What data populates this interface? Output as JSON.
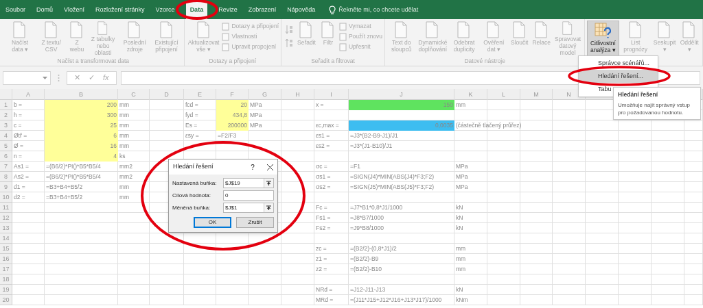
{
  "tabs": [
    {
      "label": "Soubor",
      "selected": false
    },
    {
      "label": "Domů",
      "selected": false
    },
    {
      "label": "Vložení",
      "selected": false
    },
    {
      "label": "Rozložení stránky",
      "selected": false
    },
    {
      "label": "Vzorce",
      "selected": false
    },
    {
      "label": "Data",
      "selected": true
    },
    {
      "label": "Revize",
      "selected": false
    },
    {
      "label": "Zobrazení",
      "selected": false
    },
    {
      "label": "Nápověda",
      "selected": false
    }
  ],
  "tell_me": {
    "placeholder": "Řekněte mi, co chcete udělat"
  },
  "ribbon": {
    "groups": [
      {
        "label": "Načíst a transformovat data",
        "buttons": [
          {
            "kind": "large",
            "label": "Načíst data ▾",
            "pressed": false
          },
          {
            "kind": "large",
            "label": "Z textu/ CSV",
            "pressed": false
          },
          {
            "kind": "large",
            "label": "Z webu",
            "pressed": false
          },
          {
            "kind": "large",
            "label": "Z tabulky nebo oblasti",
            "pressed": false
          },
          {
            "kind": "large",
            "label": "Poslední zdroje",
            "pressed": false
          },
          {
            "kind": "large",
            "label": "Existující připojení",
            "pressed": false
          }
        ]
      },
      {
        "label": "Dotazy a připojení",
        "buttons": [
          {
            "kind": "large",
            "label": "Aktualizovat vše ▾",
            "pressed": false
          },
          {
            "kind": "small",
            "label": "Dotazy a připojení",
            "pressed": false
          },
          {
            "kind": "small",
            "label": "Vlastnosti",
            "pressed": false
          },
          {
            "kind": "small",
            "label": "Upravit propojení",
            "pressed": false
          }
        ]
      },
      {
        "label": "Seřadit a filtrovat",
        "buttons": [
          {
            "kind": "icons",
            "pressed": false
          },
          {
            "kind": "large",
            "label": "Seřadit",
            "pressed": false
          },
          {
            "kind": "large",
            "label": "Filtr",
            "pressed": false
          },
          {
            "kind": "small",
            "label": "Vymazat",
            "pressed": false
          },
          {
            "kind": "small",
            "label": "Použít znovu",
            "pressed": false
          },
          {
            "kind": "small",
            "label": "Upřesnit",
            "pressed": false
          }
        ]
      },
      {
        "label": "Datové nástroje",
        "buttons": [
          {
            "kind": "large",
            "label": "Text do sloupců",
            "pressed": false
          },
          {
            "kind": "large",
            "label": "Dynamické doplňování",
            "pressed": false
          },
          {
            "kind": "large",
            "label": "Odebrat duplicity",
            "pressed": false
          },
          {
            "kind": "large",
            "label": "Ověření dat ▾",
            "pressed": false
          },
          {
            "kind": "large",
            "label": "Sloučit",
            "pressed": false
          },
          {
            "kind": "large",
            "label": "Relace",
            "pressed": false
          },
          {
            "kind": "large",
            "label": "Spravovat datový model",
            "pressed": false
          }
        ]
      },
      {
        "buttons": [
          {
            "kind": "large",
            "label": "Citlivostní analýza ▾",
            "pressed": true
          },
          {
            "kind": "large",
            "label": "List prognózy",
            "pressed": false
          },
          {
            "kind": "large",
            "label": "Seskupit ▾",
            "pressed": false
          },
          {
            "kind": "large",
            "label": "Oddělit ▾",
            "pressed": false
          }
        ]
      }
    ]
  },
  "formula_bar": {
    "cancel": "✕",
    "enter": "✓",
    "function": "fx"
  },
  "columns": [
    "A",
    "B",
    "C",
    "D",
    "E",
    "F",
    "G",
    "H",
    "I",
    "J",
    "K",
    "L",
    "M",
    "N"
  ],
  "rows": [
    {
      "number": "1",
      "cells": [
        {
          "kind": "text",
          "text": "b ="
        },
        {
          "kind": "number",
          "text": "200",
          "color": "#ffff99"
        },
        {
          "kind": "text",
          "text": "mm"
        },
        {},
        {
          "kind": "text",
          "text": "fcd ="
        },
        {
          "kind": "number",
          "text": "20",
          "color": "#ffff99"
        },
        {
          "kind": "text",
          "text": "MPa"
        },
        {},
        {
          "kind": "text",
          "text": "x ="
        },
        {
          "kind": "number",
          "text": "150",
          "color": "#5fe35f"
        },
        {
          "kind": "text",
          "text": "mm"
        }
      ]
    },
    {
      "number": "2",
      "cells": [
        {
          "kind": "text",
          "text": "h ="
        },
        {
          "kind": "number",
          "text": "300",
          "color": "#ffff99"
        },
        {
          "kind": "text",
          "text": "mm"
        },
        {},
        {
          "kind": "text",
          "text": "fyd ="
        },
        {
          "kind": "number",
          "text": "434,8",
          "color": "#ffff99"
        },
        {
          "kind": "text",
          "text": "MPa"
        }
      ]
    },
    {
      "number": "3",
      "cells": [
        {
          "kind": "text",
          "text": "c ="
        },
        {
          "kind": "number",
          "text": "25",
          "color": "#ffff99"
        },
        {
          "kind": "text",
          "text": "mm"
        },
        {},
        {
          "kind": "text",
          "text": "Es ="
        },
        {
          "kind": "number",
          "text": "200000",
          "color": "#ffff99"
        },
        {
          "kind": "text",
          "text": "MPa"
        },
        {},
        {
          "kind": "text",
          "text": "εc,max ="
        },
        {
          "kind": "number",
          "text": "0,0035",
          "color": "#3dbdf0"
        },
        {
          "kind": "text",
          "text": "(částečně tlačený průřez)"
        }
      ]
    },
    {
      "number": "4",
      "cells": [
        {
          "kind": "text",
          "text": "Øtř ="
        },
        {
          "kind": "number",
          "text": "6",
          "color": "#ffff99"
        },
        {
          "kind": "text",
          "text": "mm"
        },
        {},
        {
          "kind": "text",
          "text": "εsy ="
        },
        {
          "kind": "text",
          "text": "=F2/F3"
        },
        {},
        {},
        {
          "kind": "text",
          "text": "εs1 ="
        },
        {
          "kind": "text",
          "text": "=J3*(B2-B9-J1)/J1"
        }
      ]
    },
    {
      "number": "5",
      "cells": [
        {
          "kind": "text",
          "text": "Ø ="
        },
        {
          "kind": "number",
          "text": "16",
          "color": "#ffff99"
        },
        {
          "kind": "text",
          "text": "mm"
        },
        {},
        {},
        {},
        {},
        {},
        {
          "kind": "text",
          "text": "εs2 ="
        },
        {
          "kind": "text",
          "text": "=J3*(J1-B10)/J1"
        }
      ]
    },
    {
      "number": "6",
      "cells": [
        {
          "kind": "text",
          "text": "n ="
        },
        {
          "kind": "number",
          "text": "4",
          "color": "#ffff99"
        },
        {
          "kind": "text",
          "text": "ks"
        }
      ]
    },
    {
      "number": "7",
      "cells": [
        {
          "kind": "text",
          "text": "As1 ="
        },
        {
          "kind": "text",
          "text": "=(B6/2)*PI()*B5*B5/4"
        },
        {
          "kind": "text",
          "text": "mm2"
        },
        {},
        {},
        {},
        {},
        {},
        {
          "kind": "text",
          "text": "σc ="
        },
        {
          "kind": "text",
          "text": "=F1"
        },
        {
          "kind": "text",
          "text": "MPa"
        }
      ]
    },
    {
      "number": "8",
      "cells": [
        {
          "kind": "text",
          "text": "As2 ="
        },
        {
          "kind": "text",
          "text": "=(B6/2)*PI()*B5*B5/4"
        },
        {
          "kind": "text",
          "text": "mm2"
        },
        {},
        {},
        {},
        {},
        {},
        {
          "kind": "text",
          "text": "σs1 ="
        },
        {
          "kind": "text",
          "text": "=SIGN(J4)*MIN(ABS(J4)*F3;F2)"
        },
        {
          "kind": "text",
          "text": "MPa"
        }
      ]
    },
    {
      "number": "9",
      "cells": [
        {
          "kind": "text",
          "text": "d1 ="
        },
        {
          "kind": "text",
          "text": "=B3+B4+B5/2"
        },
        {
          "kind": "text",
          "text": "mm"
        },
        {},
        {},
        {},
        {},
        {},
        {
          "kind": "text",
          "text": "σs2 ="
        },
        {
          "kind": "text",
          "text": "=SIGN(J5)*MIN(ABS(J5)*F3;F2)"
        },
        {
          "kind": "text",
          "text": "MPa"
        }
      ]
    },
    {
      "number": "10",
      "cells": [
        {
          "kind": "text",
          "text": "d2 ="
        },
        {
          "kind": "text",
          "text": "=B3+B4+B5/2"
        },
        {
          "kind": "text",
          "text": "mm"
        }
      ]
    },
    {
      "number": "11",
      "cells": [
        {},
        {},
        {},
        {},
        {},
        {},
        {},
        {},
        {
          "kind": "text",
          "text": "Fc ="
        },
        {
          "kind": "text",
          "text": "=J7*B1*0,8*J1/1000"
        },
        {
          "kind": "text",
          "text": "kN"
        }
      ]
    },
    {
      "number": "12",
      "cells": [
        {},
        {},
        {},
        {},
        {},
        {},
        {},
        {},
        {
          "kind": "text",
          "text": "Fs1 ="
        },
        {
          "kind": "text",
          "text": "=J8*B7/1000"
        },
        {
          "kind": "text",
          "text": "kN"
        }
      ]
    },
    {
      "number": "13",
      "cells": [
        {},
        {},
        {},
        {},
        {},
        {},
        {},
        {},
        {
          "kind": "text",
          "text": "Fs2 ="
        },
        {
          "kind": "text",
          "text": "=J9*B8/1000"
        },
        {
          "kind": "text",
          "text": "kN"
        }
      ]
    },
    {
      "number": "14",
      "cells": []
    },
    {
      "number": "15",
      "cells": [
        {},
        {},
        {},
        {},
        {},
        {},
        {},
        {},
        {
          "kind": "text",
          "text": "zc ="
        },
        {
          "kind": "text",
          "text": "=(B2/2)-(0,8*J1)/2"
        },
        {
          "kind": "text",
          "text": "mm"
        }
      ]
    },
    {
      "number": "16",
      "cells": [
        {},
        {},
        {},
        {},
        {},
        {},
        {},
        {},
        {
          "kind": "text",
          "text": "z1 ="
        },
        {
          "kind": "text",
          "text": "=(B2/2)-B9"
        },
        {
          "kind": "text",
          "text": "mm"
        }
      ]
    },
    {
      "number": "17",
      "cells": [
        {},
        {},
        {},
        {},
        {},
        {},
        {},
        {},
        {
          "kind": "text",
          "text": "z2 ="
        },
        {
          "kind": "text",
          "text": "=(B2/2)-B10"
        },
        {
          "kind": "text",
          "text": "mm"
        }
      ]
    },
    {
      "number": "18",
      "cells": []
    },
    {
      "number": "19",
      "cells": [
        {},
        {},
        {},
        {},
        {},
        {},
        {},
        {},
        {
          "kind": "text",
          "text": "NRd ="
        },
        {
          "kind": "text",
          "text": "=J12-J11-J13"
        },
        {
          "kind": "text",
          "text": "kN"
        }
      ]
    },
    {
      "number": "20",
      "cells": [
        {},
        {},
        {},
        {},
        {},
        {},
        {},
        {},
        {
          "kind": "text",
          "text": "MRd ="
        },
        {
          "kind": "text",
          "text": "=(J11*J15+J12*J16+J13*J17)/1000"
        },
        {
          "kind": "text",
          "text": "kNm"
        }
      ]
    }
  ],
  "dialog": {
    "title": "Hledání řešení",
    "help": "?",
    "fields": [
      {
        "label": "Nastavená buňka:",
        "value": "$J$19",
        "kind": "reference"
      },
      {
        "label": "Cílová hodnota:",
        "value": "0",
        "kind": "plain"
      },
      {
        "label": "Měněná buňka:",
        "value": "$J$1",
        "kind": "reference"
      }
    ],
    "buttons": [
      {
        "label": "OK",
        "default": true
      },
      {
        "label": "Zrušit",
        "default": false
      }
    ]
  },
  "menu": {
    "items": [
      {
        "label": "Správce scénářů...",
        "selected": false
      },
      {
        "label": "Hledání řešení...",
        "selected": true
      },
      {
        "label": "Tabu",
        "selected": false
      }
    ]
  },
  "tooltip": {
    "title": "Hledání řešení",
    "text": "Umožňuje najít správný vstup pro požadovanou hodnotu."
  }
}
